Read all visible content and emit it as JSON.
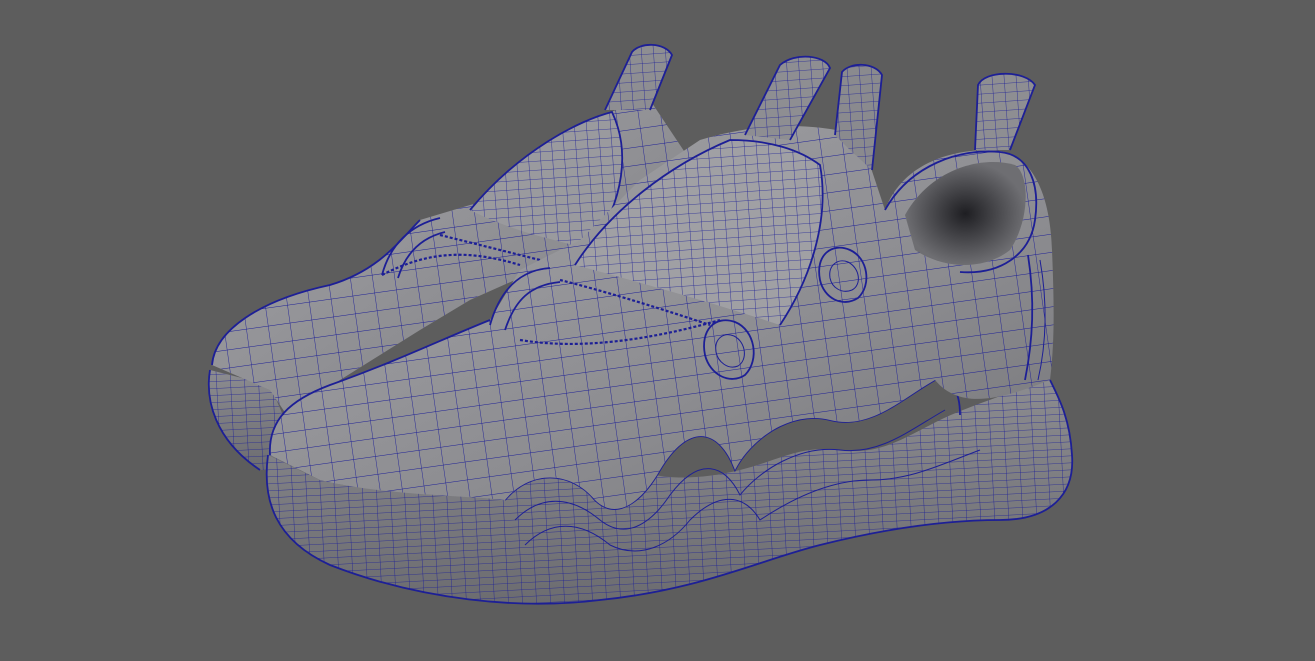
{
  "viewport": {
    "background": "#5d5d5d",
    "display_mode": "wireframe-on-shaded"
  },
  "model": {
    "object": "sneaker-pair",
    "shade_color": "#8f8f93",
    "wire_color": "#1d1f96"
  }
}
